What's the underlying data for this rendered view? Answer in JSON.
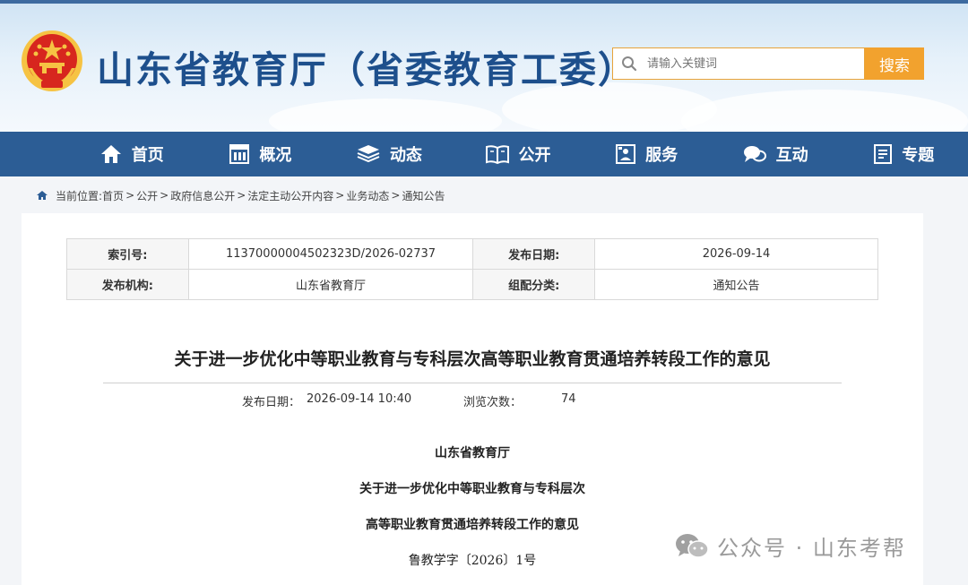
{
  "header": {
    "site_title": "山东省教育厅（省委教育工委）",
    "search_placeholder": "请输入关键词",
    "search_button": "搜索"
  },
  "nav": {
    "items": [
      {
        "label": "首页",
        "icon": "home-icon"
      },
      {
        "label": "概况",
        "icon": "building-icon"
      },
      {
        "label": "动态",
        "icon": "stack-icon"
      },
      {
        "label": "公开",
        "icon": "book-icon"
      },
      {
        "label": "服务",
        "icon": "service-icon"
      },
      {
        "label": "互动",
        "icon": "chat-icon"
      },
      {
        "label": "专题",
        "icon": "document-icon"
      }
    ]
  },
  "breadcrumb": {
    "prefix": "当前位置:",
    "items": [
      "首页",
      "公开",
      "政府信息公开",
      "法定主动公开内容",
      "业务动态",
      "通知公告"
    ],
    "separator": ">"
  },
  "meta": {
    "index_label": "索引号:",
    "index_value": "11370000004502323D/2026-02737",
    "date_label": "发布日期:",
    "date_value": "2026-09-14",
    "org_label": "发布机构:",
    "org_value": "山东省教育厅",
    "category_label": "组配分类:",
    "category_value": "通知公告"
  },
  "article": {
    "title": "关于进一步优化中等职业教育与专科层次高等职业教育贯通培养转段工作的意见",
    "publish_label": "发布日期：",
    "publish_value": "2026-09-14 10:40",
    "views_label": "浏览次数：",
    "views_value": "74",
    "issuer": "山东省教育厅",
    "heading_line1": "关于进一步优化中等职业教育与专科层次",
    "heading_line2": "高等职业教育贯通培养转段工作的意见",
    "doc_number": "鲁教学字〔2026〕1号"
  },
  "watermark": {
    "text": "公众号 · 山东考帮"
  },
  "colors": {
    "nav_bg": "#2c5d95",
    "title_blue": "#1d4f8c",
    "search_orange": "#f2a22e",
    "emblem_red": "#d7261e",
    "emblem_gold": "#f6c343"
  }
}
